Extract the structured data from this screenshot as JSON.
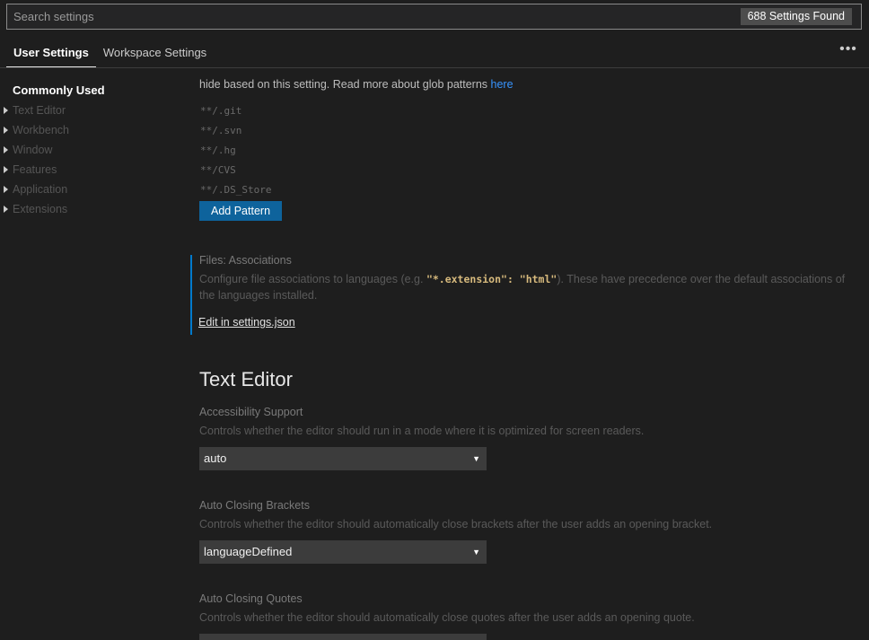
{
  "search": {
    "placeholder": "Search settings",
    "count_label": "688 Settings Found"
  },
  "tabs": [
    {
      "label": "User Settings",
      "active": true
    },
    {
      "label": "Workspace Settings",
      "active": false
    }
  ],
  "more_actions_icon": "ellipsis-icon",
  "toc": {
    "items": [
      {
        "label": "Commonly Used",
        "selected": true
      },
      {
        "label": "Text Editor"
      },
      {
        "label": "Workbench"
      },
      {
        "label": "Window"
      },
      {
        "label": "Features"
      },
      {
        "label": "Application"
      },
      {
        "label": "Extensions"
      }
    ]
  },
  "files_exclude": {
    "description_tail": "hide based on this setting. Read more about glob patterns ",
    "link": "here",
    "patterns": [
      "**/.git",
      "**/.svn",
      "**/.hg",
      "**/CVS",
      "**/.DS_Store"
    ],
    "add_button": "Add Pattern"
  },
  "files_associations": {
    "title": "Files: Associations",
    "desc_before": "Configure file associations to languages (e.g. ",
    "code": "\"*.extension\": \"html\"",
    "desc_after": "). These have precedence over the default associations of",
    "desc_line2": "the languages installed.",
    "edit_link": "Edit in settings.json"
  },
  "text_editor": {
    "heading": "Text Editor",
    "settings": [
      {
        "title": "Accessibility Support",
        "description": "Controls whether the editor should run in a mode where it is optimized for screen readers.",
        "value": "auto"
      },
      {
        "title": "Auto Closing Brackets",
        "description": "Controls whether the editor should automatically close brackets after the user adds an opening bracket.",
        "value": "languageDefined"
      },
      {
        "title": "Auto Closing Quotes",
        "description": "Controls whether the editor should automatically close quotes after the user adds an opening quote.",
        "value": ""
      }
    ]
  },
  "colors": {
    "background": "#1e1e1e",
    "accent": "#007acc",
    "button": "#0e639c",
    "link": "#3794ff"
  }
}
